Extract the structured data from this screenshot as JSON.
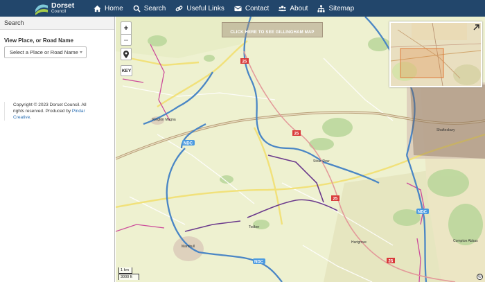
{
  "header": {
    "logo_line1": "Dorset",
    "logo_line2": "Council",
    "nav": [
      {
        "label": "Home",
        "icon": "home-icon"
      },
      {
        "label": "Search",
        "icon": "search-icon"
      },
      {
        "label": "Useful Links",
        "icon": "link-icon"
      },
      {
        "label": "Contact",
        "icon": "envelope-icon"
      },
      {
        "label": "About",
        "icon": "users-icon"
      },
      {
        "label": "Sitemap",
        "icon": "sitemap-icon"
      }
    ],
    "bg_color": "#22466b"
  },
  "sidebar": {
    "title": "Search",
    "view_label": "View Place, or Road Name",
    "select_value": "Select a Place or Road Name",
    "copyright_text": "Copyright © 2023 Dorset Council. All rights reserved. Produced by ",
    "copyright_link": "Pindar Creative",
    "copyright_end": "."
  },
  "map": {
    "zoom_in": "+",
    "zoom_out": "−",
    "key_label": "KEY",
    "gillingham_banner": "CLICK HERE TO SEE GILLINGHAM MAP",
    "scale_km": "1 km",
    "scale_ft": "3000 ft",
    "info": "©",
    "places": [
      "Kington Magna",
      "Shaftesbury",
      "Stour Row",
      "Todber",
      "Marnhull",
      "Hartgrove",
      "Compton Abbas"
    ],
    "route_labels": [
      "25",
      "25",
      "25",
      "25",
      "NDC",
      "NDC",
      "NDC"
    ],
    "colors": {
      "land": "#eef1d0",
      "woodland": "#b9d69a",
      "route_blue": "#4a86c5",
      "route_purple": "#6b3a8c",
      "route_pink": "#cc4a9a",
      "road_yellow": "#f1e17a",
      "road_brown": "#b79e76"
    }
  }
}
